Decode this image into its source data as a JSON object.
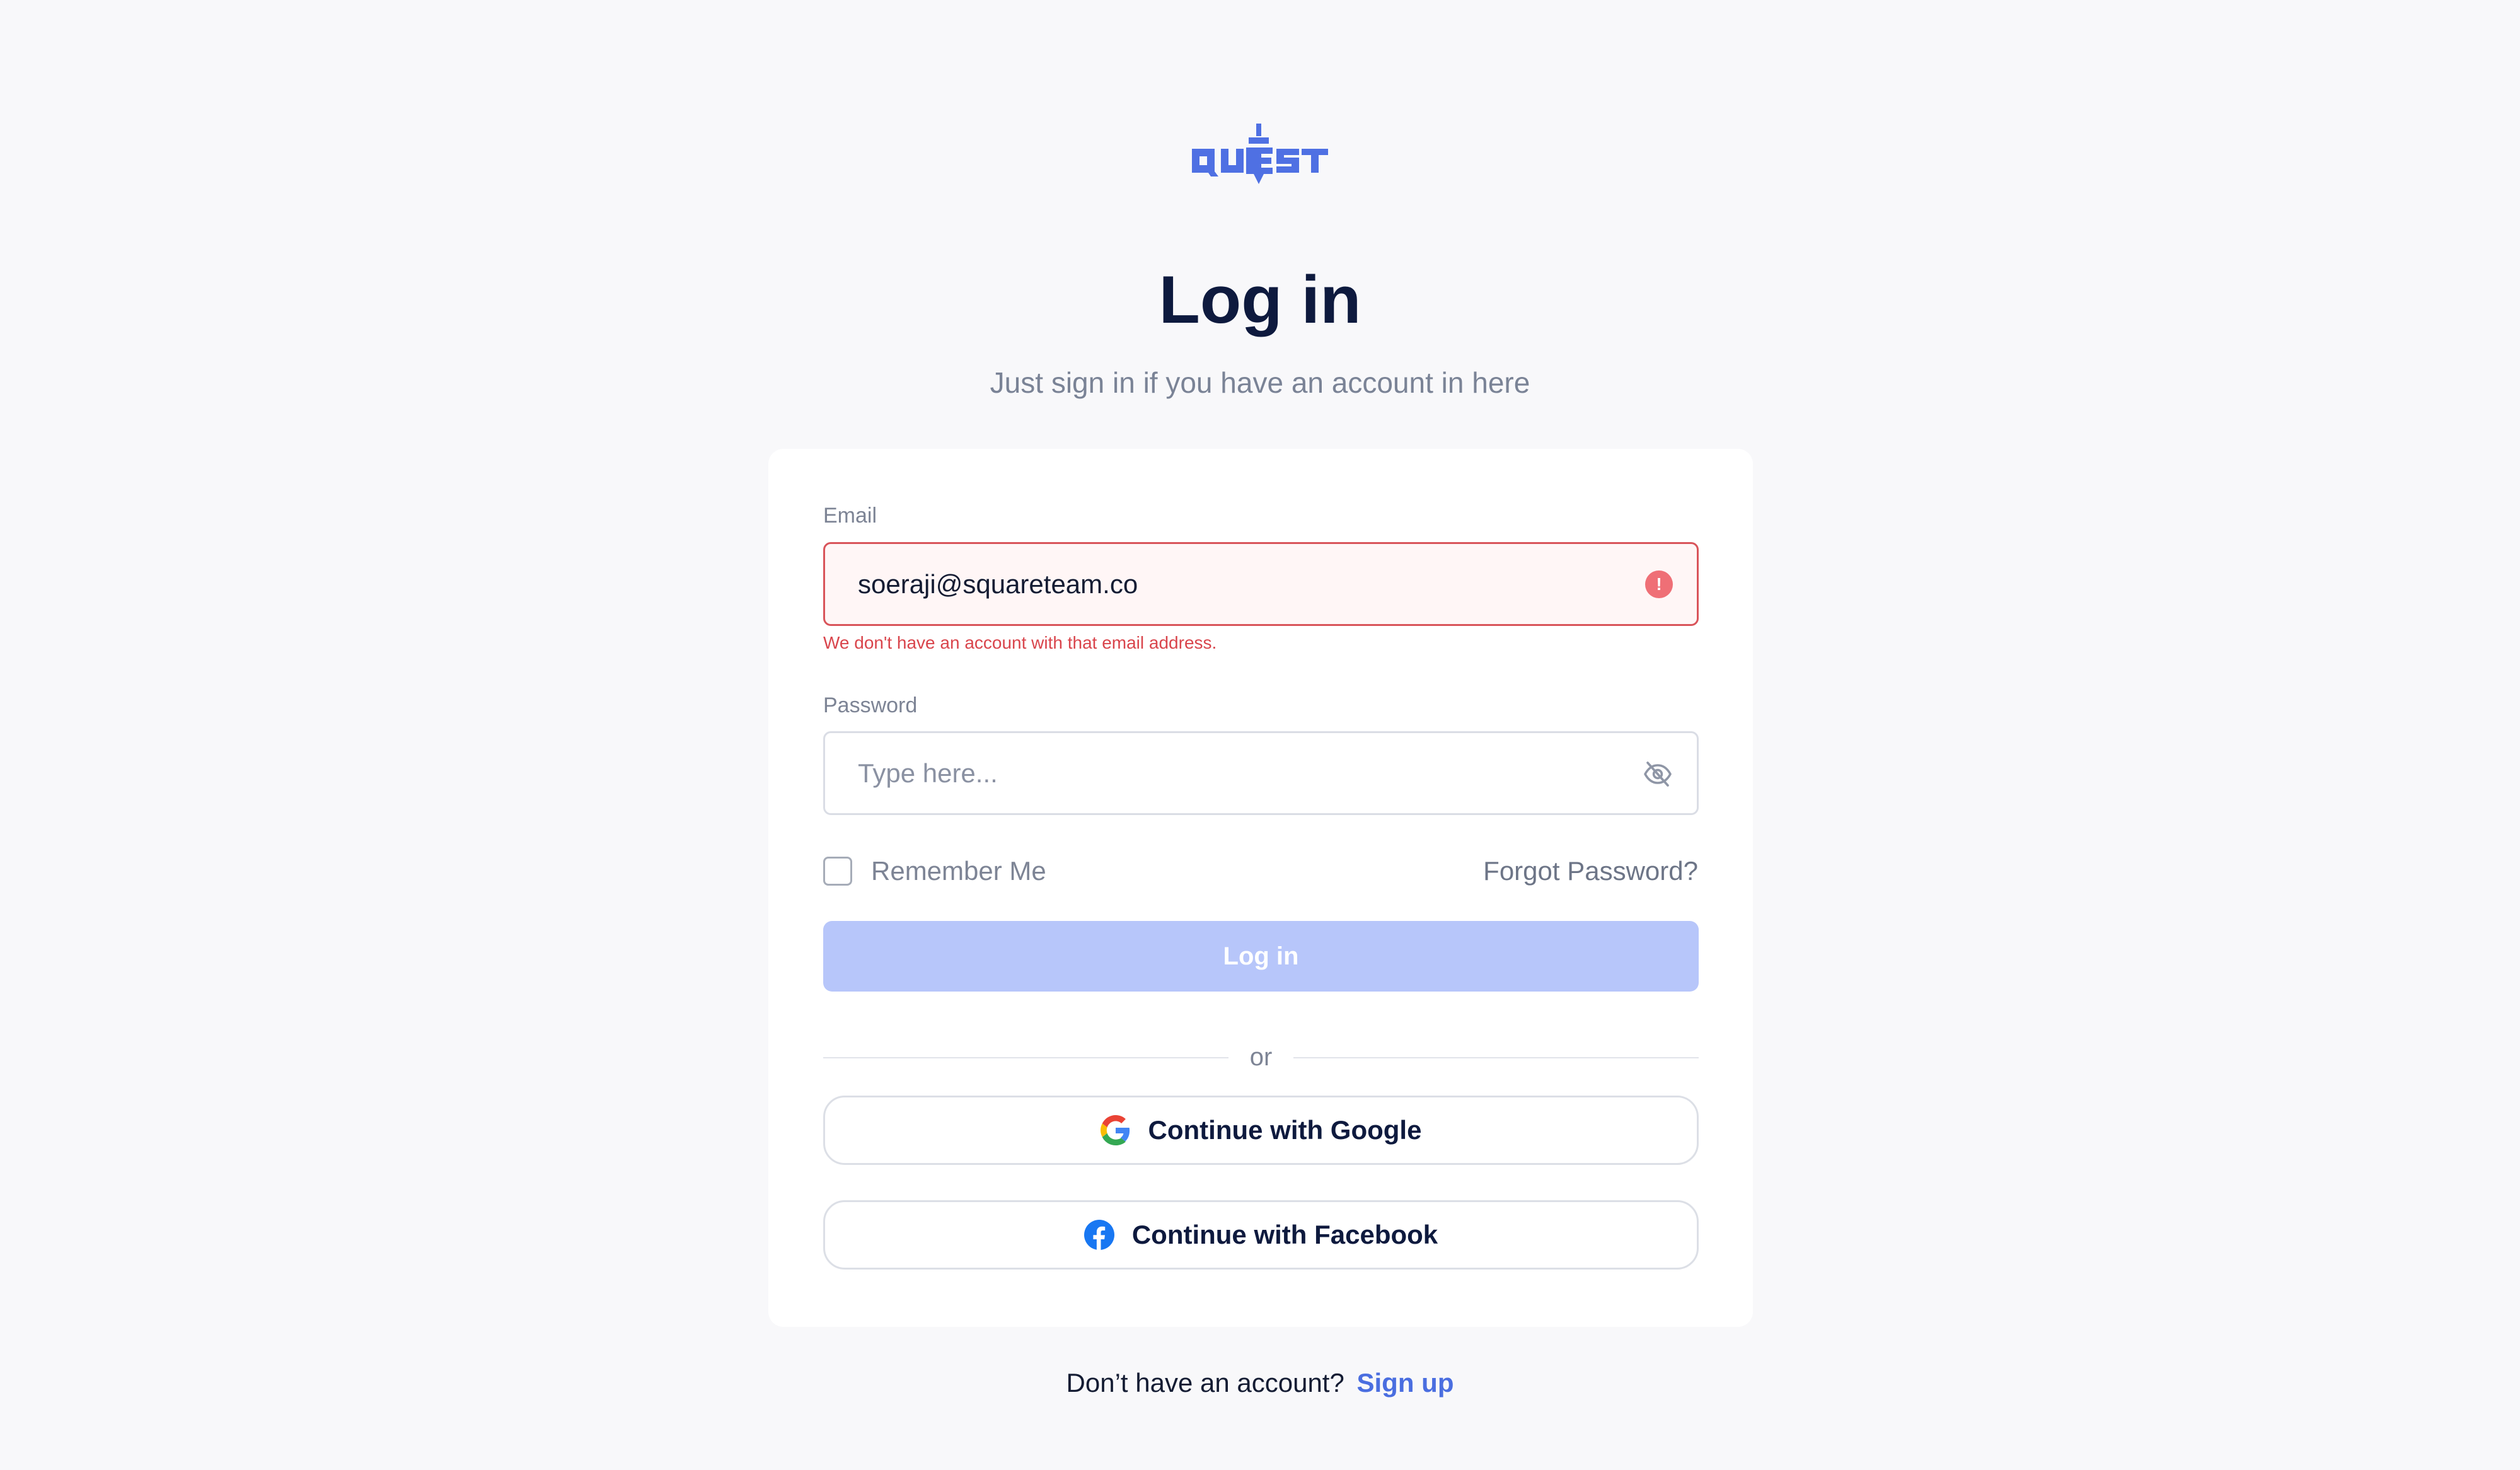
{
  "brand": {
    "logo_text": "QUEST",
    "accent_color": "#4a6ee0"
  },
  "header": {
    "title": "Log in",
    "subtitle": "Just sign in if you have an account in here"
  },
  "form": {
    "email": {
      "label": "Email",
      "value": "soeraji@squareteam.co",
      "error": "We don't have an account with that email address.",
      "error_icon": "!"
    },
    "password": {
      "label": "Password",
      "placeholder": "Type here..."
    },
    "remember_label": "Remember Me",
    "remember_checked": false,
    "forgot_label": "Forgot Password?",
    "login_label": "Log in",
    "divider_text": "or"
  },
  "social": {
    "google_label": "Continue with Google",
    "facebook_label": "Continue with Facebook"
  },
  "footer": {
    "prompt": "Don’t have an account?",
    "signup_label": "Sign up"
  }
}
